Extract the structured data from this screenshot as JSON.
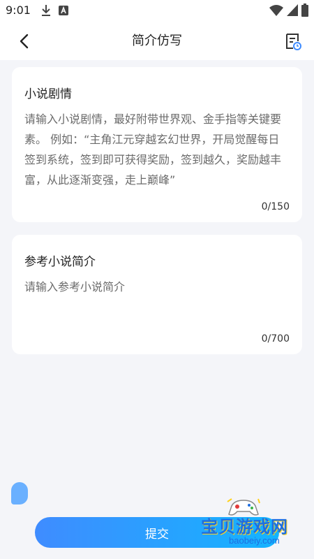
{
  "status_bar": {
    "time": "9:01",
    "icons": [
      "download-icon",
      "a-app-icon",
      "wifi-icon",
      "signal-icon",
      "battery-icon"
    ]
  },
  "header": {
    "title": "简介仿写",
    "back_icon": "chevron-left-icon",
    "history_icon": "history-doc-icon"
  },
  "cards": {
    "plot": {
      "title": "小说剧情",
      "placeholder": "请输入小说剧情，最好附带世界观、金手指等关键要素。 例如：“主角江元穿越玄幻世界，开局觉醒每日签到系统，签到即可获得奖励，签到越久，奖励越丰富，从此逐渐变强，走上巅峰”",
      "value": "",
      "counter": "0/150"
    },
    "reference": {
      "title": "参考小说简介",
      "placeholder": "请输入参考小说简介",
      "value": "",
      "counter": "0/700"
    }
  },
  "submit": {
    "label": "提交"
  },
  "watermark": {
    "title": "宝贝游戏网",
    "url": "baobeiy.com"
  },
  "colors": {
    "accent_start": "#3f8cff",
    "accent_end": "#14b4ff",
    "background": "#f4f5f9",
    "card": "#ffffff"
  }
}
